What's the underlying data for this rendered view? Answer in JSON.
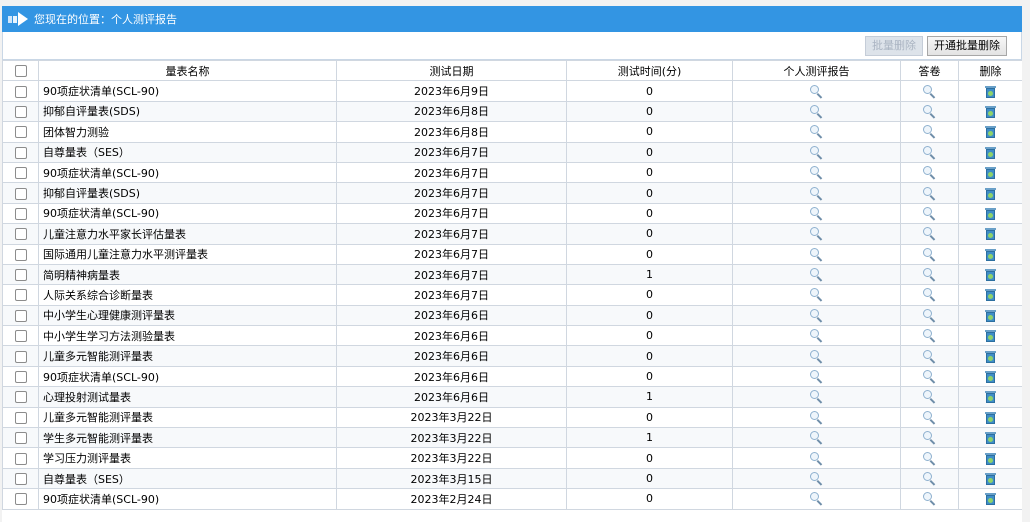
{
  "header": {
    "location_text": "您现在的位置：个人测评报告"
  },
  "toolbar": {
    "batch_delete_label": "批量删除",
    "enable_batch_delete_label": "开通批量删除"
  },
  "table": {
    "columns": [
      "量表名称",
      "测试日期",
      "测试时间(分)",
      "个人测评报告",
      "答卷",
      "删除"
    ],
    "rows": [
      {
        "name": "90项症状清单(SCL-90)",
        "date": "2023年6月9日",
        "minutes": "0"
      },
      {
        "name": "抑郁自评量表(SDS)",
        "date": "2023年6月8日",
        "minutes": "0"
      },
      {
        "name": "团体智力测验",
        "date": "2023年6月8日",
        "minutes": "0"
      },
      {
        "name": "自尊量表（SES）",
        "date": "2023年6月7日",
        "minutes": "0"
      },
      {
        "name": "90项症状清单(SCL-90)",
        "date": "2023年6月7日",
        "minutes": "0"
      },
      {
        "name": "抑郁自评量表(SDS)",
        "date": "2023年6月7日",
        "minutes": "0"
      },
      {
        "name": "90项症状清单(SCL-90)",
        "date": "2023年6月7日",
        "minutes": "0"
      },
      {
        "name": "儿童注意力水平家长评估量表",
        "date": "2023年6月7日",
        "minutes": "0"
      },
      {
        "name": "国际通用儿童注意力水平测评量表",
        "date": "2023年6月7日",
        "minutes": "0"
      },
      {
        "name": "简明精神病量表",
        "date": "2023年6月7日",
        "minutes": "1"
      },
      {
        "name": "人际关系综合诊断量表",
        "date": "2023年6月7日",
        "minutes": "0"
      },
      {
        "name": "中小学生心理健康测评量表",
        "date": "2023年6月6日",
        "minutes": "0"
      },
      {
        "name": "中小学生学习方法测验量表",
        "date": "2023年6月6日",
        "minutes": "0"
      },
      {
        "name": "儿童多元智能测评量表",
        "date": "2023年6月6日",
        "minutes": "0"
      },
      {
        "name": "90项症状清单(SCL-90)",
        "date": "2023年6月6日",
        "minutes": "0"
      },
      {
        "name": "心理投射测试量表",
        "date": "2023年6月6日",
        "minutes": "1"
      },
      {
        "name": "儿童多元智能测评量表",
        "date": "2023年3月22日",
        "minutes": "0"
      },
      {
        "name": "学生多元智能测评量表",
        "date": "2023年3月22日",
        "minutes": "1"
      },
      {
        "name": "学习压力测评量表",
        "date": "2023年3月22日",
        "minutes": "0"
      },
      {
        "name": "自尊量表（SES）",
        "date": "2023年3月15日",
        "minutes": "0"
      },
      {
        "name": "90项症状清单(SCL-90)",
        "date": "2023年2月24日",
        "minutes": "0"
      }
    ]
  },
  "icons": {
    "report": "magnifier-icon",
    "answers": "magnifier-icon",
    "delete": "trash-icon"
  },
  "colors": {
    "header_bg": "#3395e3",
    "border": "#d0d7e0"
  }
}
